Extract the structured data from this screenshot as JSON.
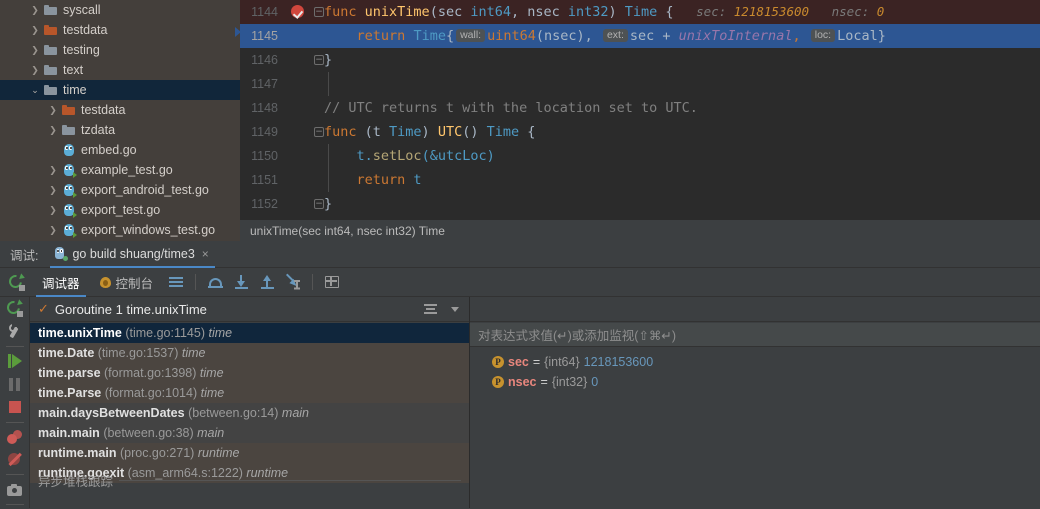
{
  "project_tree": {
    "items": [
      {
        "label": "syscall",
        "indent": 1,
        "icon": "folder-icon",
        "arrow": "right",
        "selected": false,
        "orange": false
      },
      {
        "label": "testdata",
        "indent": 1,
        "icon": "folder-icon",
        "arrow": "right",
        "selected": false,
        "orange": true
      },
      {
        "label": "testing",
        "indent": 1,
        "icon": "folder-icon",
        "arrow": "right",
        "selected": false,
        "orange": false
      },
      {
        "label": "text",
        "indent": 1,
        "icon": "folder-icon",
        "arrow": "right",
        "selected": false,
        "orange": false
      },
      {
        "label": "time",
        "indent": 1,
        "icon": "folder-icon",
        "arrow": "down",
        "selected": true,
        "orange": false
      },
      {
        "label": "testdata",
        "indent": 2,
        "icon": "folder-icon",
        "arrow": "right",
        "selected": false,
        "orange": true
      },
      {
        "label": "tzdata",
        "indent": 2,
        "icon": "folder-icon",
        "arrow": "right",
        "selected": false,
        "orange": false
      },
      {
        "label": "embed.go",
        "indent": 2,
        "icon": "go-file-icon",
        "arrow": "none",
        "selected": false,
        "orange": false
      },
      {
        "label": "example_test.go",
        "indent": 2,
        "icon": "go-test-file-icon",
        "arrow": "right",
        "selected": false,
        "orange": false
      },
      {
        "label": "export_android_test.go",
        "indent": 2,
        "icon": "go-test-file-icon",
        "arrow": "right",
        "selected": false,
        "orange": false
      },
      {
        "label": "export_test.go",
        "indent": 2,
        "icon": "go-test-file-icon",
        "arrow": "right",
        "selected": false,
        "orange": false
      },
      {
        "label": "export_windows_test.go",
        "indent": 2,
        "icon": "go-test-file-icon",
        "arrow": "right",
        "selected": false,
        "orange": false
      }
    ]
  },
  "editor": {
    "status_bar": "unixTime(sec int64, nsec int32) Time",
    "lines": [
      {
        "no": "1144",
        "state": "breakpoint",
        "fold": "minus",
        "breakpoint": true
      },
      {
        "no": "1145",
        "state": "executing",
        "fold": "none",
        "breakpoint": false
      },
      {
        "no": "1146",
        "state": "normal",
        "fold": "minus-end",
        "breakpoint": false
      },
      {
        "no": "1147",
        "state": "normal",
        "fold": "none",
        "breakpoint": false
      },
      {
        "no": "1148",
        "state": "normal",
        "fold": "none",
        "breakpoint": false
      },
      {
        "no": "1149",
        "state": "normal",
        "fold": "minus",
        "breakpoint": false
      },
      {
        "no": "1150",
        "state": "normal",
        "fold": "none",
        "breakpoint": false
      },
      {
        "no": "1151",
        "state": "normal",
        "fold": "none",
        "breakpoint": false
      },
      {
        "no": "1152",
        "state": "normal",
        "fold": "minus-end",
        "breakpoint": false
      }
    ],
    "code": {
      "l1144_kw": "func",
      "l1144_fn": "unixTime",
      "l1144_sig": "(sec ",
      "l1144_t1": "int64",
      "l1144_sig2": ", nsec ",
      "l1144_t2": "int32",
      "l1144_sig3": ") ",
      "l1144_t3": "Time",
      "l1144_brace": " {",
      "l1144_hint_sec_key": "sec:",
      "l1144_hint_sec_val": "1218153600",
      "l1144_hint_nsec_key": "nsec:",
      "l1144_hint_nsec_val": "0",
      "l1145_return": "return",
      "l1145_type": "Time",
      "l1145_brace": "{",
      "l1145_p_wall": "wall:",
      "l1145_wall_fn": "uint64",
      "l1145_wall_arg": "(nsec),",
      "l1145_p_ext": "ext:",
      "l1145_ext_a": "sec + ",
      "l1145_ext_b": "unixToInternal",
      "l1145_ext_c": ",",
      "l1145_p_loc": "loc:",
      "l1145_loc_v": "Local}",
      "l1146": "}",
      "l1148_comment": "// UTC returns t with the location set to UTC.",
      "l1149_kw": "func",
      "l1149_recv": " (t ",
      "l1149_recv_t": "Time",
      "l1149_recv_close": ") ",
      "l1149_fn": "UTC",
      "l1149_paren": "() ",
      "l1149_ret": "Time",
      "l1149_brace": " {",
      "l1150_a": "t.",
      "l1150_b": "setLoc",
      "l1150_c": "(&utcLoc)",
      "l1151_kw": "return",
      "l1151_v": " t",
      "l1152": "}"
    }
  },
  "debug_window": {
    "title": "调试:",
    "run_tab": {
      "label": "go build shuang/time3",
      "close": "×"
    },
    "toolbar": {
      "rerun_icon": "rerun-icon",
      "tabs": [
        {
          "label": "调试器",
          "active": true,
          "icon": null
        },
        {
          "label": "控制台",
          "active": false,
          "icon": "flame-icon"
        }
      ],
      "actions": [
        {
          "name": "show-execution-point",
          "icon": "lines-icon"
        },
        {
          "name": "step-over",
          "icon": "step-over-icon"
        },
        {
          "name": "step-into",
          "icon": "step-into-icon"
        },
        {
          "name": "step-out",
          "icon": "step-out-icon"
        },
        {
          "name": "run-to-cursor",
          "icon": "run-to-cursor-icon"
        },
        {
          "name": "evaluate-expression",
          "icon": "evaluate-icon"
        }
      ]
    },
    "side_actions": [
      {
        "name": "rerun",
        "icon": "rerun-icon"
      },
      {
        "name": "settings",
        "icon": "wrench-icon"
      },
      {
        "name": "resume-program",
        "icon": "resume-icon"
      },
      {
        "name": "pause-program",
        "icon": "pause-icon"
      },
      {
        "name": "stop",
        "icon": "stop-icon"
      },
      {
        "name": "view-breakpoints",
        "icon": "breakpoints-icon"
      },
      {
        "name": "mute-breakpoints",
        "icon": "mute-breakpoints-icon"
      },
      {
        "name": "screenshot",
        "icon": "camera-icon"
      }
    ],
    "frames": {
      "header": {
        "label": "Goroutine 1 time.unixTime",
        "check": "✓"
      },
      "async_label": "异步堆栈跟踪",
      "rows": [
        {
          "name": "time.unixTime",
          "loc": "(time.go:1145)",
          "pkg": "time",
          "group": "lib",
          "selected": true
        },
        {
          "name": "time.Date",
          "loc": "(time.go:1537)",
          "pkg": "time",
          "group": "lib",
          "selected": false
        },
        {
          "name": "time.parse",
          "loc": "(format.go:1398)",
          "pkg": "time",
          "group": "lib",
          "selected": false
        },
        {
          "name": "time.Parse",
          "loc": "(format.go:1014)",
          "pkg": "time",
          "group": "lib",
          "selected": false
        },
        {
          "name": "main.daysBetweenDates",
          "loc": "(between.go:14)",
          "pkg": "main",
          "group": "usr",
          "selected": false
        },
        {
          "name": "main.main",
          "loc": "(between.go:38)",
          "pkg": "main",
          "group": "usr",
          "selected": false
        },
        {
          "name": "runtime.main",
          "loc": "(proc.go:271)",
          "pkg": "runtime",
          "group": "lib",
          "selected": false
        },
        {
          "name": "runtime.goexit",
          "loc": "(asm_arm64.s:1222)",
          "pkg": "runtime",
          "group": "lib",
          "selected": false
        }
      ]
    },
    "variables": {
      "watch_placeholder": "对表达式求值(↵)或添加监视(⇧⌘↵)",
      "rows": [
        {
          "badge": "P",
          "name": "sec",
          "eq": "=",
          "type": "{int64}",
          "value": "1218153600"
        },
        {
          "badge": "P",
          "name": "nsec",
          "eq": "=",
          "type": "{int32}",
          "value": "0"
        }
      ]
    }
  },
  "colors": {
    "tree_bg": "#443f3b",
    "selection_blue": "#11263a",
    "editor_bg": "#2b2b2b",
    "exec_line": "#2d5693",
    "breakpoint_line": "#3b2323",
    "accent_tab": "#4a88c7",
    "keyword": "#cc7832",
    "function": "#ffc66d",
    "type": "#4e9ac4",
    "comment": "#808080",
    "number": "#6897bb",
    "var_name": "#e8867d"
  }
}
